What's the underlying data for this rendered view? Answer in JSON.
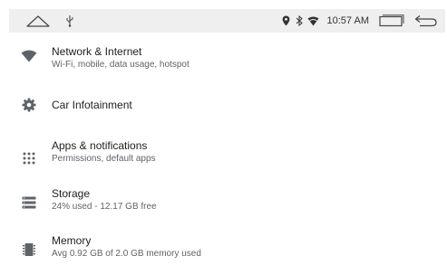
{
  "status_bar": {
    "time": "10:57 AM",
    "icons": [
      "home-icon",
      "usb-icon",
      "location-icon",
      "bluetooth-icon",
      "wifi-signal-icon",
      "recents-icon",
      "back-icon"
    ]
  },
  "settings": {
    "items": [
      {
        "icon": "wifi-icon",
        "title": "Network & Internet",
        "subtitle": "Wi-Fi, mobile, data usage, hotspot"
      },
      {
        "icon": "gear-icon",
        "title": "Car Infotainment",
        "subtitle": ""
      },
      {
        "icon": "apps-grid-icon",
        "title": "Apps & notifications",
        "subtitle": "Permissions, default apps"
      },
      {
        "icon": "storage-icon",
        "title": "Storage",
        "subtitle": "24% used - 12.17 GB free"
      },
      {
        "icon": "memory-icon",
        "title": "Memory",
        "subtitle": "Avg 0.92 GB of 2.0 GB memory used"
      }
    ]
  },
  "colors": {
    "status_bar_bg": "#efefef",
    "icon": "#5f6368",
    "title_text": "#202124",
    "subtitle_text": "#5f6368"
  }
}
